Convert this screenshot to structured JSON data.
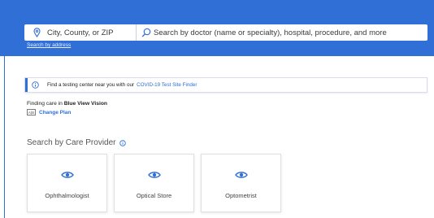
{
  "search": {
    "location_placeholder": "City, County, or ZIP",
    "query_placeholder": "Search by doctor (name or specialty), hospital, procedure, and more",
    "by_address_link": "Search by address",
    "location_icon": "map-pin-icon",
    "search_icon": "search-icon"
  },
  "notice": {
    "text": "Find a testing center near you with our",
    "link": "COVID-19 Test Site Finder",
    "icon": "info-icon"
  },
  "plan": {
    "prefix": "Finding care in",
    "name": "Blue View Vision",
    "change_label": "Change Plan",
    "icon_text": "A|B"
  },
  "providers": {
    "heading": "Search by Care Provider",
    "items": [
      {
        "label": "Ophthalmologist",
        "icon": "eye-icon"
      },
      {
        "label": "Optical Store",
        "icon": "eye-icon"
      },
      {
        "label": "Optometrist",
        "icon": "eye-icon"
      }
    ]
  },
  "colors": {
    "brand_blue": "#2f6fd6",
    "text": "#222222",
    "muted": "#555555"
  }
}
